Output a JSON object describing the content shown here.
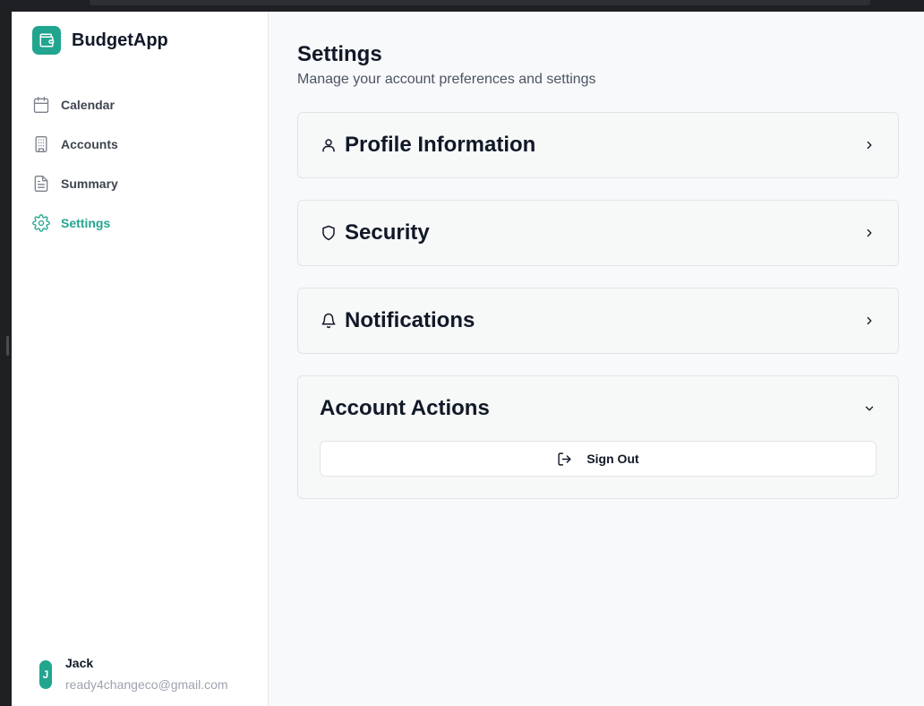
{
  "brand": {
    "name": "BudgetApp"
  },
  "sidebar": {
    "items": [
      {
        "label": "Calendar",
        "icon": "calendar-icon",
        "active": false
      },
      {
        "label": "Accounts",
        "icon": "building-icon",
        "active": false
      },
      {
        "label": "Summary",
        "icon": "file-text-icon",
        "active": false
      },
      {
        "label": "Settings",
        "icon": "gear-icon",
        "active": true
      }
    ]
  },
  "user": {
    "initial": "J",
    "name": "Jack",
    "email": "ready4changeco@gmail.com"
  },
  "main": {
    "title": "Settings",
    "subtitle": "Manage your account preferences and settings",
    "sections": [
      {
        "title": "Profile Information",
        "icon": "user-icon",
        "expanded": false
      },
      {
        "title": "Security",
        "icon": "shield-icon",
        "expanded": false
      },
      {
        "title": "Notifications",
        "icon": "bell-icon",
        "expanded": false
      },
      {
        "title": "Account Actions",
        "icon": "",
        "expanded": true
      }
    ],
    "sign_out_label": "Sign Out"
  },
  "colors": {
    "accent": "#21a58f",
    "text": "#111827",
    "muted": "#4b5563"
  }
}
